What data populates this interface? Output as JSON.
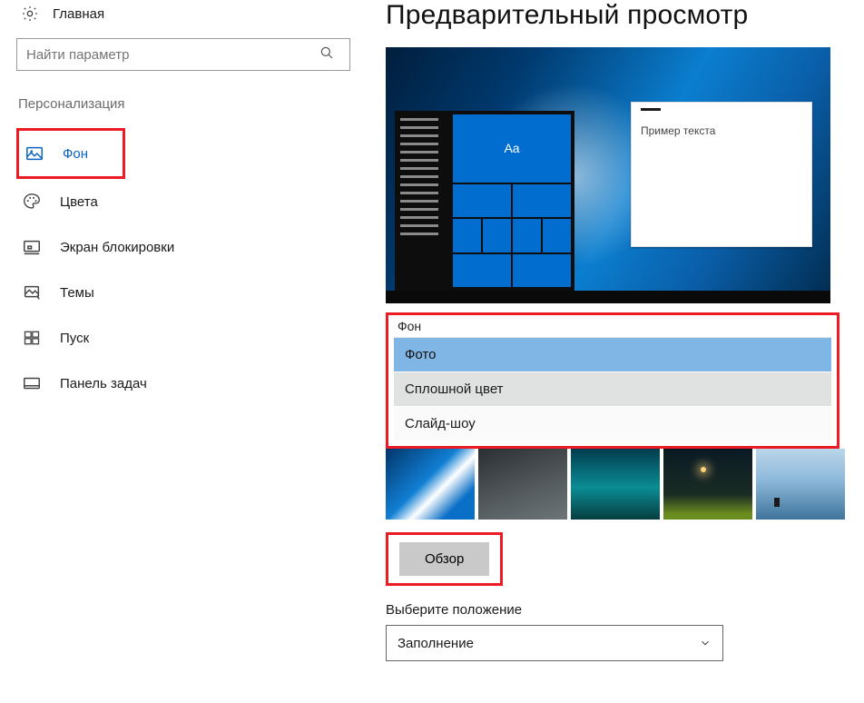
{
  "sidebar": {
    "home_label": "Главная",
    "search_placeholder": "Найти параметр",
    "section_title": "Персонализация",
    "items": [
      {
        "label": "Фон"
      },
      {
        "label": "Цвета"
      },
      {
        "label": "Экран блокировки"
      },
      {
        "label": "Темы"
      },
      {
        "label": "Пуск"
      },
      {
        "label": "Панель задач"
      }
    ]
  },
  "main": {
    "preview_title": "Предварительный просмотр",
    "sample_text": "Пример текста",
    "tile_text": "Aa",
    "background": {
      "label": "Фон",
      "options": [
        "Фото",
        "Сплошной цвет",
        "Слайд-шоу"
      ],
      "selected_index": 0
    },
    "browse_label": "Обзор",
    "position_label": "Выберите положение",
    "position_value": "Заполнение"
  }
}
